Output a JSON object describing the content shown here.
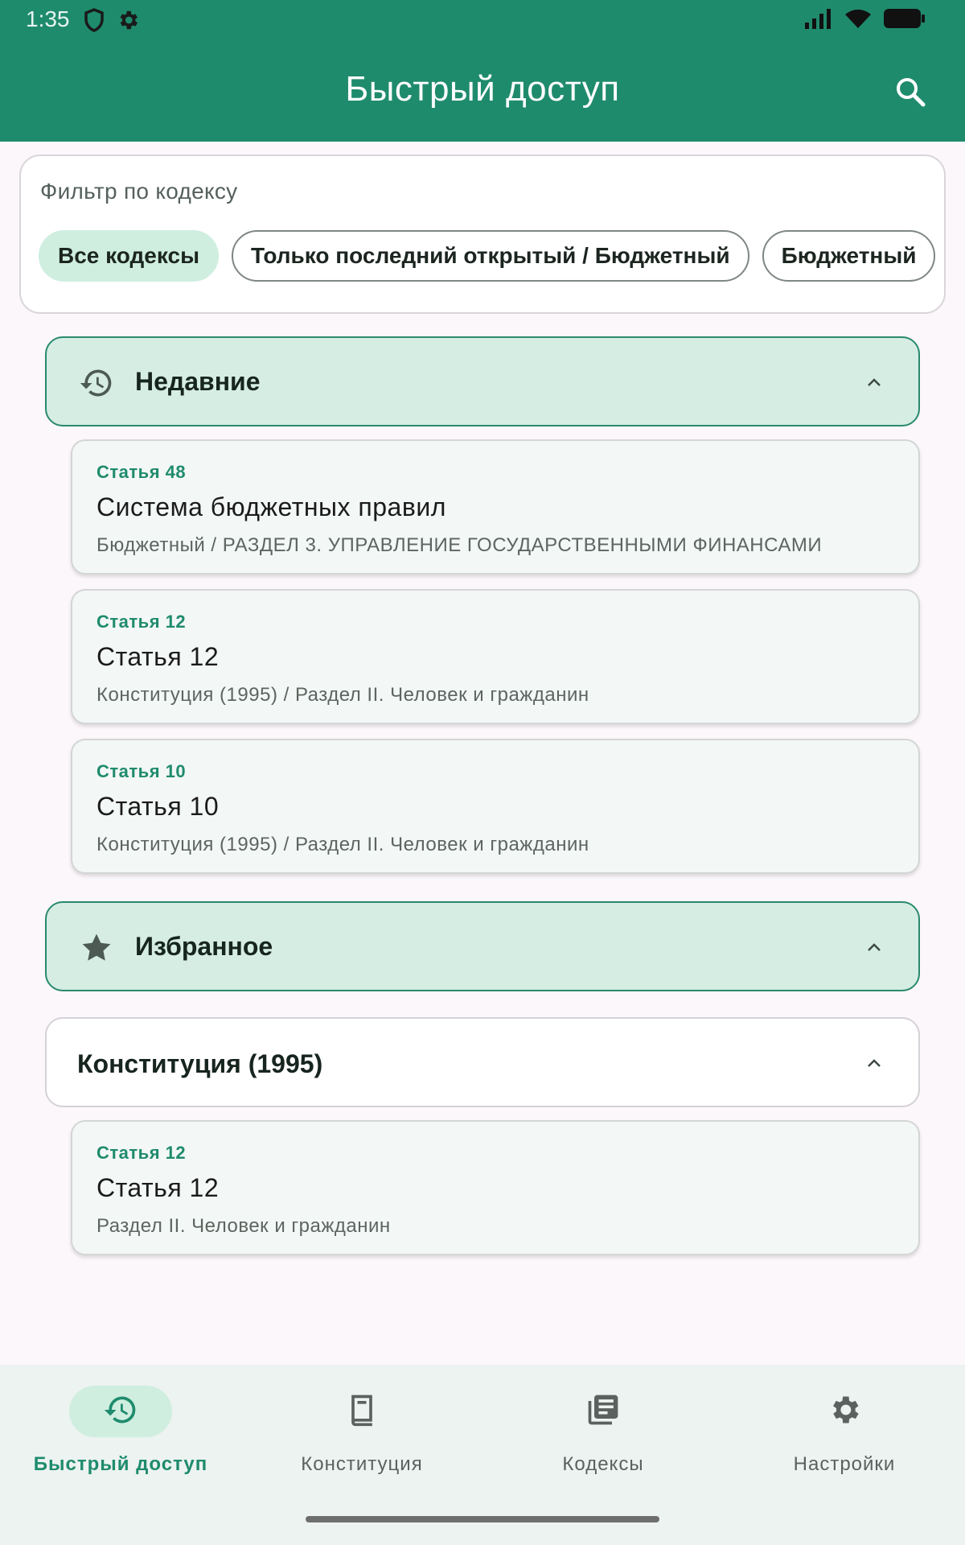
{
  "status_bar": {
    "time": "1:35",
    "left_icons": [
      "shield-icon",
      "gear-icon"
    ],
    "right_icons": [
      "signal-icon",
      "wifi-icon",
      "battery-icon"
    ]
  },
  "app_bar": {
    "title": "Быстрый доступ",
    "search_icon": "search-icon"
  },
  "filter": {
    "title": "Фильтр по кодексу",
    "chips": [
      {
        "label": "Все кодексы",
        "selected": true
      },
      {
        "label": "Только последний открытый / Бюджетный",
        "selected": false
      },
      {
        "label": "Бюджетный",
        "selected": false
      }
    ]
  },
  "recent": {
    "title": "Недавние",
    "icon": "history-icon",
    "items": [
      {
        "number": "Статья 48",
        "title": "Система бюджетных правил",
        "path": "Бюджетный / РАЗДЕЛ 3. УПРАВЛЕНИЕ ГОСУДАРСТВЕННЫМИ ФИНАНСАМИ"
      },
      {
        "number": "Статья 12",
        "title": "Статья 12",
        "path": "Конституция (1995) / Раздел II. Человек и гражданин"
      },
      {
        "number": "Статья 10",
        "title": "Статья 10",
        "path": "Конституция (1995) / Раздел II. Человек и гражданин"
      }
    ]
  },
  "favorites": {
    "title": "Избранное",
    "icon": "star-icon",
    "groups": [
      {
        "title": "Конституция (1995)",
        "items": [
          {
            "number": "Статья 12",
            "title": "Статья 12",
            "path": "Раздел II. Человек и гражданин"
          }
        ]
      }
    ]
  },
  "bottom_nav": {
    "items": [
      {
        "label": "Быстрый доступ",
        "icon": "history-icon",
        "active": true
      },
      {
        "label": "Конституция",
        "icon": "book-icon",
        "active": false
      },
      {
        "label": "Кодексы",
        "icon": "library-icon",
        "active": false
      },
      {
        "label": "Настройки",
        "icon": "gear-icon",
        "active": false
      }
    ]
  },
  "colors": {
    "primary": "#1f8b6d",
    "chip_selected": "#cfeee0",
    "section_bg": "#d5ede3",
    "card_bg": "#f3f7f5"
  }
}
